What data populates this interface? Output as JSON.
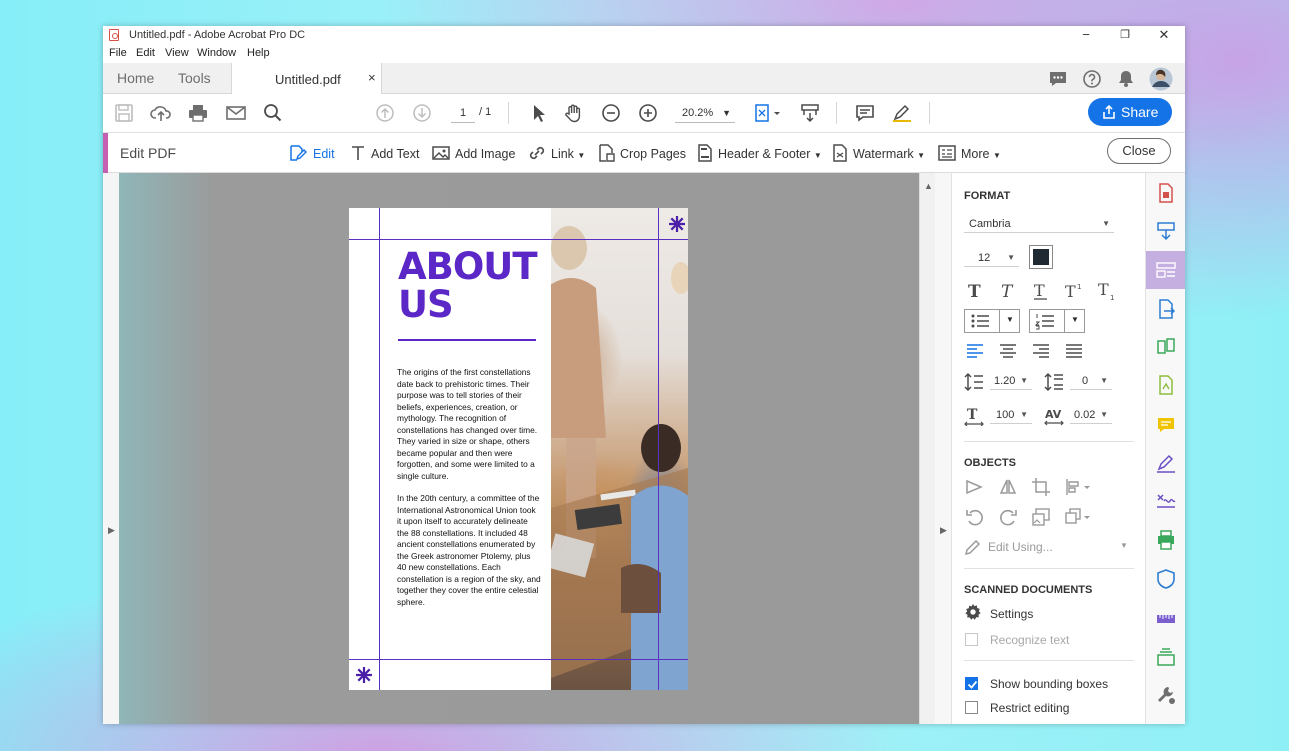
{
  "window": {
    "title": "Untitled.pdf - Adobe Acrobat Pro DC",
    "controls": {
      "minimize": "−",
      "restore": "❐",
      "close": "✕"
    }
  },
  "menu": {
    "items": [
      "File",
      "Edit",
      "View",
      "Window",
      "Help"
    ]
  },
  "tabs": {
    "home": "Home",
    "tools": "Tools",
    "document": "Untitled.pdf",
    "close": "×"
  },
  "toolbar": {
    "page_current": "1",
    "page_total": "/ 1",
    "zoom": "20.2%",
    "share_label": "Share"
  },
  "edit_bar": {
    "title": "Edit PDF",
    "items": {
      "edit": "Edit",
      "add_text": "Add Text",
      "add_image": "Add Image",
      "link": "Link",
      "crop_pages": "Crop Pages",
      "header_footer": "Header & Footer",
      "watermark": "Watermark",
      "more": "More"
    },
    "close_label": "Close"
  },
  "document": {
    "heading_line1": "ABOUT",
    "heading_line2": "US",
    "paragraph1": "The origins of the first constellations date back to prehistoric times. Their purpose was to tell stories of their beliefs, experiences, creation, or mythology. The recognition of constellations has changed over time. They varied in size or shape, others became popular and then were forgotten, and some were limited to a single culture.",
    "paragraph2": "In the 20th century, a committee of the International Astronomical Union took it upon itself to accurately delineate the 88 constellations. It included 48 ancient constellations enumerated by the Greek astronomer Ptolemy, plus 40 new constellations. Each constellation is a region of the sky, and together they cover the entire celestial sphere.",
    "accent_color": "#5b27c6"
  },
  "format_panel": {
    "format_title": "FORMAT",
    "font": "Cambria",
    "size": "12",
    "text_color": "#1f2a33",
    "line_spacing": "1.20",
    "para_spacing": "0",
    "h_scale": "100",
    "char_spacing": "0.02",
    "objects_title": "OBJECTS",
    "edit_using": "Edit Using...",
    "scanned_title": "SCANNED DOCUMENTS",
    "settings_label": "Settings",
    "recognize_text": "Recognize text",
    "show_bounding_boxes": "Show bounding boxes",
    "restrict_editing": "Restrict editing",
    "show_bounding_checked": true,
    "restrict_checked": false
  },
  "colors": {
    "accent_blue": "#1473e6",
    "edit_accent": "#c45fb2"
  }
}
